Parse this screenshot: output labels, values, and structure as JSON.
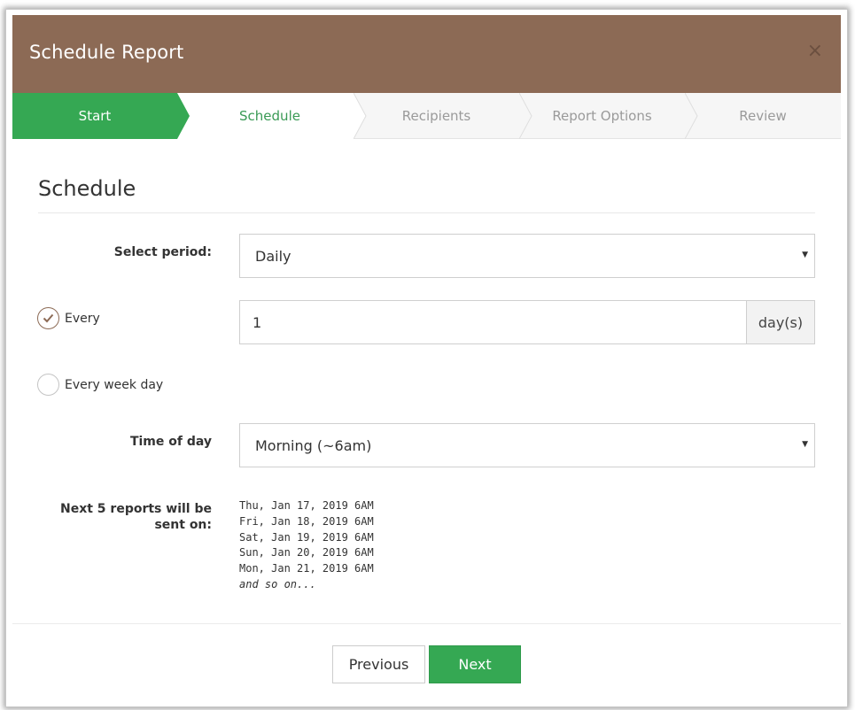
{
  "modal": {
    "title": "Schedule Report",
    "close_symbol": "×"
  },
  "wizard": {
    "steps": [
      {
        "label": "Start",
        "state": "completed"
      },
      {
        "label": "Schedule",
        "state": "active"
      },
      {
        "label": "Recipients",
        "state": "pending"
      },
      {
        "label": "Report Options",
        "state": "pending"
      },
      {
        "label": "Review",
        "state": "pending"
      }
    ]
  },
  "section": {
    "title": "Schedule"
  },
  "form": {
    "period_label": "Select period:",
    "period_value": "Daily",
    "every_label": "Every",
    "every_checked": true,
    "every_value": "1",
    "every_unit": "day(s)",
    "weekday_label": "Every week day",
    "weekday_checked": false,
    "time_label": "Time of day",
    "time_value": "Morning (~6am)",
    "next_label_line1": "Next 5 reports will be",
    "next_label_line2": "sent on:",
    "next_dates": [
      "Thu, Jan 17, 2019 6AM",
      "Fri, Jan 18, 2019 6AM",
      "Sat, Jan 19, 2019 6AM",
      "Sun, Jan 20, 2019 6AM",
      "Mon, Jan 21, 2019 6AM"
    ],
    "next_more": "and so on..."
  },
  "footer": {
    "previous_label": "Previous",
    "next_label": "Next"
  },
  "colors": {
    "header_bg": "#8c6a55",
    "accent_green": "#35a853",
    "active_step_text": "#3a9a55"
  }
}
